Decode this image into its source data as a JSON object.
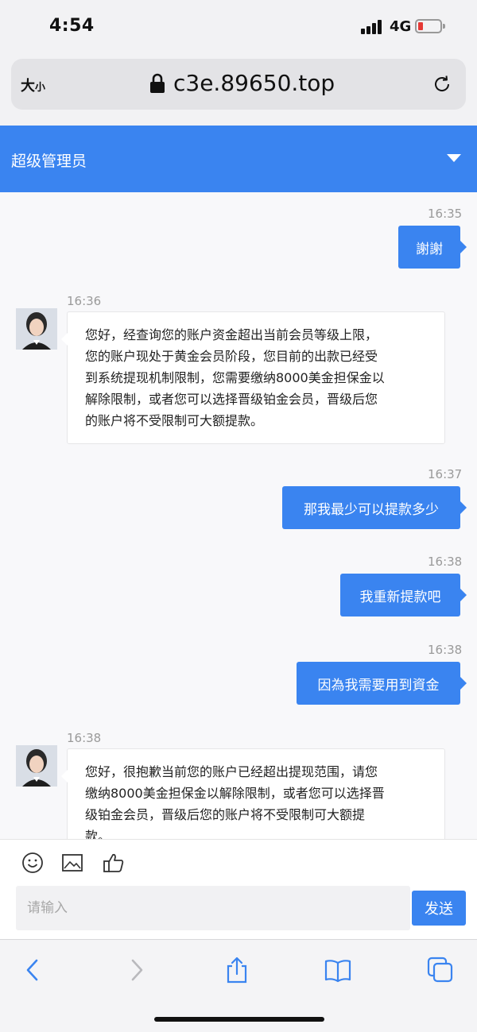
{
  "status_bar": {
    "time": "4:54",
    "network": "4G"
  },
  "browser": {
    "text_size_label": "大",
    "text_size_small": "小",
    "url": "c3e.89650.top"
  },
  "chat": {
    "title": "超级管理员",
    "messages": [
      {
        "side": "out",
        "time": "16:35",
        "text": "謝謝"
      },
      {
        "side": "in",
        "time": "16:36",
        "lines": [
          "您好，经查询您的账户资金超出当前会员等级上限，",
          "您的账户现处于黄金会员阶段，您目前的出款已经受",
          "到系统提现机制限制，您需要缴纳8000美金担保金以",
          "解除限制，或者您可以选择晋级铂金会员，晋级后您",
          "的账户将不受限制可大额提款。"
        ]
      },
      {
        "side": "out",
        "time": "16:37",
        "text": "那我最少可以提款多少"
      },
      {
        "side": "out",
        "time": "16:38",
        "text": "我重新提款吧"
      },
      {
        "side": "out",
        "time": "16:38",
        "text": "因為我需要用到資金"
      },
      {
        "side": "in",
        "time": "16:38",
        "lines": [
          "您好，很抱歉当前您的账户已经超出提现范围，请您",
          "缴纳8000美金担保金以解除限制，或者您可以选择晋",
          "级铂金会员，晋级后您的账户将不受限制可大额提",
          "款。"
        ]
      }
    ]
  },
  "composer": {
    "placeholder": "请输入",
    "send_label": "发送"
  },
  "colors": {
    "accent": "#3a84f0",
    "battery_low": "#e53935"
  }
}
